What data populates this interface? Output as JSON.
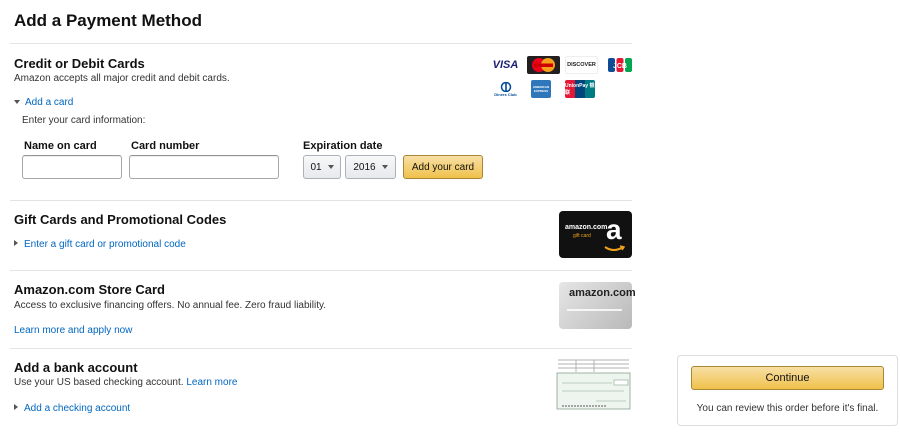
{
  "page": {
    "title": "Add a Payment Method"
  },
  "cards": {
    "title": "Credit or Debit Cards",
    "subtitle": "Amazon accepts all major credit and debit cards.",
    "add_link": "Add a card",
    "enter_info": "Enter your card information:",
    "name_label": "Name on card",
    "number_label": "Card number",
    "expiration_label": "Expiration date",
    "month_value": "01",
    "year_value": "2016",
    "add_button": "Add your card",
    "logos": [
      {
        "name": "visa",
        "text": "VISA"
      },
      {
        "name": "mastercard",
        "text": "MasterCard"
      },
      {
        "name": "discover",
        "text": "DISCOVER"
      },
      {
        "name": "jcb",
        "text": "JCB"
      },
      {
        "name": "diners",
        "text": "Diners Club"
      },
      {
        "name": "amex",
        "text": "AMERICAN EXPRESS"
      },
      {
        "name": "unionpay",
        "text": "UnionPay 银联"
      }
    ]
  },
  "gift": {
    "title": "Gift Cards and Promotional Codes",
    "link": "Enter a gift card or promotional code",
    "card_brand": "amazon.com",
    "card_sub": "gift card",
    "card_letter": "a"
  },
  "store_card": {
    "title": "Amazon.com Store Card",
    "subtitle": "Access to exclusive financing offers. No annual fee. Zero fraud liability.",
    "link": "Learn more and apply now",
    "card_brand": "amazon.com"
  },
  "bank": {
    "title": "Add a bank account",
    "subtitle": "Use your US based checking account.",
    "learn_more": "Learn more",
    "link": "Add a checking account"
  },
  "sidebar": {
    "continue": "Continue",
    "note": "You can review this order before it's final."
  },
  "colors": {
    "link": "#0066c0",
    "button_yellow": "#f0c14b",
    "divider": "#e3e3e3"
  }
}
